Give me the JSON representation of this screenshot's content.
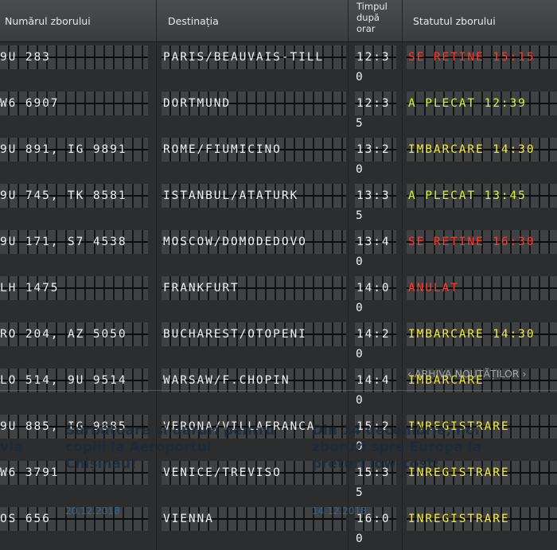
{
  "header": {
    "col_flight": "Numărul zborului",
    "col_dest": "Destinația",
    "col_time": "Timpul\ndupă\norar",
    "col_status": "Statutul zborului"
  },
  "rows": [
    {
      "flight": "9U 283",
      "dest": "PARIS/BEAUVAIS-TILL",
      "time": "12:3",
      "time_wrap": "0",
      "status": "SE RETINE 15:15",
      "status_color": "red"
    },
    {
      "flight": "W6 6907",
      "dest": "DORTMUND",
      "time": "12:3",
      "time_wrap": "5",
      "status": "A PLECAT 12:39",
      "status_color": "green"
    },
    {
      "flight": "9U 891, IG 9891",
      "dest": "ROME/FIUMICINO",
      "time": "13:2",
      "time_wrap": "0",
      "status": "IMBARCARE 14:30",
      "status_color": "yellow"
    },
    {
      "flight": "9U 745, TK 8581",
      "dest": "ISTANBUL/ATATURK",
      "time": "13:3",
      "time_wrap": "5",
      "status": "A PLECAT 13:45",
      "status_color": "green"
    },
    {
      "flight": "9U 171, S7 4538",
      "dest": "MOSCOW/DOMODEDOVO",
      "time": "13:4",
      "time_wrap": "0",
      "status": "SE RETINE 16:30",
      "status_color": "red"
    },
    {
      "flight": "LH 1475",
      "dest": "FRANKFURT",
      "time": "14:0",
      "time_wrap": "0",
      "status": "ANULAT",
      "status_color": "red"
    },
    {
      "flight": "RO 204, AZ 5050",
      "dest": "BUCHAREST/OTOPENI",
      "time": "14:2",
      "time_wrap": "0",
      "status": "IMBARCARE 14:30",
      "status_color": "yellow"
    },
    {
      "flight": "LO 514, 9U 9514",
      "dest": "WARSAW/F.CHOPIN",
      "time": "14:4",
      "time_wrap": "0",
      "status": "IMBARCARE",
      "status_color": "yellow"
    },
    {
      "flight": "9U 885, IG 9885",
      "dest": "VERONA/VILLAFRANCA",
      "time": "15:2",
      "time_wrap": "0",
      "status": "INREGISTRARE",
      "status_color": "yellow"
    },
    {
      "flight": "W6 3791",
      "dest": "VENICE/TREVISO",
      "time": "15:3",
      "time_wrap": "5",
      "status": "INREGISTRARE",
      "status_color": "yellow"
    },
    {
      "flight": "OS 656",
      "dest": "VIENNA",
      "time": "16:0",
      "time_wrap": "0",
      "status": "INREGISTRARE",
      "status_color": "yellow"
    }
  ],
  "news": {
    "archive_label": "ARHIVA NOUTĂȚILOR",
    "items": [
      {
        "title_partial": "via",
        "date": ""
      },
      {
        "title": "Sărbătoare și daruri pentru copiii la Aeroportul Chișinău!",
        "date": "20.12.2018"
      },
      {
        "title": "Din 14 decembrie, noi zboruri spre Europa la prețuri low-cost!",
        "date": "14.12.2018"
      }
    ]
  },
  "colors": {
    "red": "#ff3b2f",
    "yellow": "#f4ec3a",
    "green": "#d9f23a",
    "white": "#f2f2f2"
  }
}
